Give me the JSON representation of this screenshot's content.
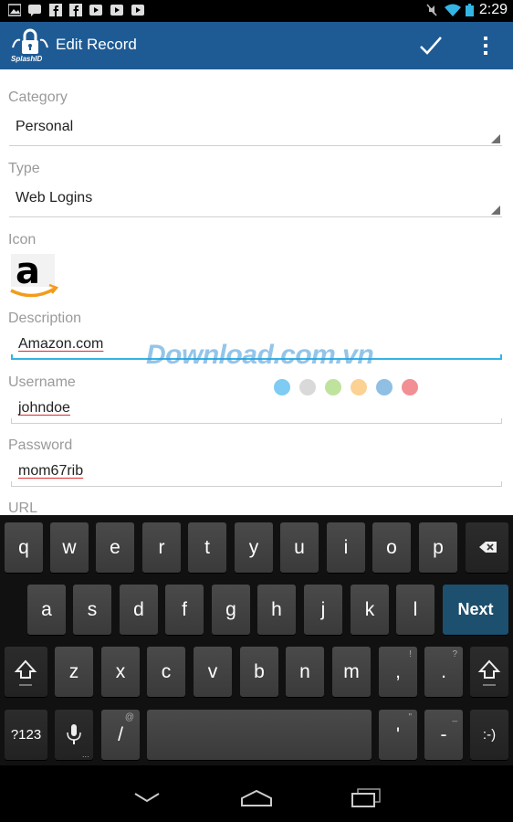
{
  "status_bar": {
    "time": "2:29",
    "left_icons": [
      "picture-icon",
      "talk-icon",
      "facebook-icon",
      "facebook-icon",
      "play-icon",
      "play-icon",
      "play-icon"
    ],
    "right_icons": [
      "mute-icon",
      "wifi-icon",
      "battery-icon"
    ]
  },
  "action_bar": {
    "logo_text": "SplashID",
    "title": "Edit Record",
    "confirm_icon": "checkmark-icon",
    "overflow_icon": "overflow-menu-icon",
    "bg_color": "#1e5b95"
  },
  "form": {
    "category": {
      "label": "Category",
      "value": "Personal"
    },
    "type": {
      "label": "Type",
      "value": "Web Logins"
    },
    "icon": {
      "label": "Icon",
      "name": "amazon-logo-icon"
    },
    "description": {
      "label": "Description",
      "value": "Amazon.com"
    },
    "username": {
      "label": "Username",
      "value": "johndoe"
    },
    "password": {
      "label": "Password",
      "value": "mom67rib"
    },
    "url": {
      "label": "URL"
    }
  },
  "watermark": {
    "text": "Download.com.vn",
    "dot_colors": [
      "#7ecbf3",
      "#d9d9d9",
      "#bfe39c",
      "#fbd294",
      "#8fbfe3",
      "#f28f95"
    ]
  },
  "keyboard": {
    "row1": [
      "q",
      "w",
      "e",
      "r",
      "t",
      "y",
      "u",
      "i",
      "o",
      "p"
    ],
    "row2": [
      "a",
      "s",
      "d",
      "f",
      "g",
      "h",
      "j",
      "k",
      "l"
    ],
    "row3": [
      "z",
      "x",
      "c",
      "v",
      "b",
      "n",
      "m",
      ",",
      "."
    ],
    "row3_hints": [
      "!",
      "?"
    ],
    "row4": {
      "symbols": "?123",
      "slash": "/",
      "slash_hint": "@",
      "apostrophe": "'",
      "apostrophe_hint": "\"",
      "dash": "-",
      "dash_hint": "_",
      "smiley": ":-)"
    },
    "next_label": "Next",
    "accent_color": "#1d4f6e"
  },
  "nav_bar": {
    "icons": [
      "back-icon",
      "home-icon",
      "recent-apps-icon"
    ]
  }
}
